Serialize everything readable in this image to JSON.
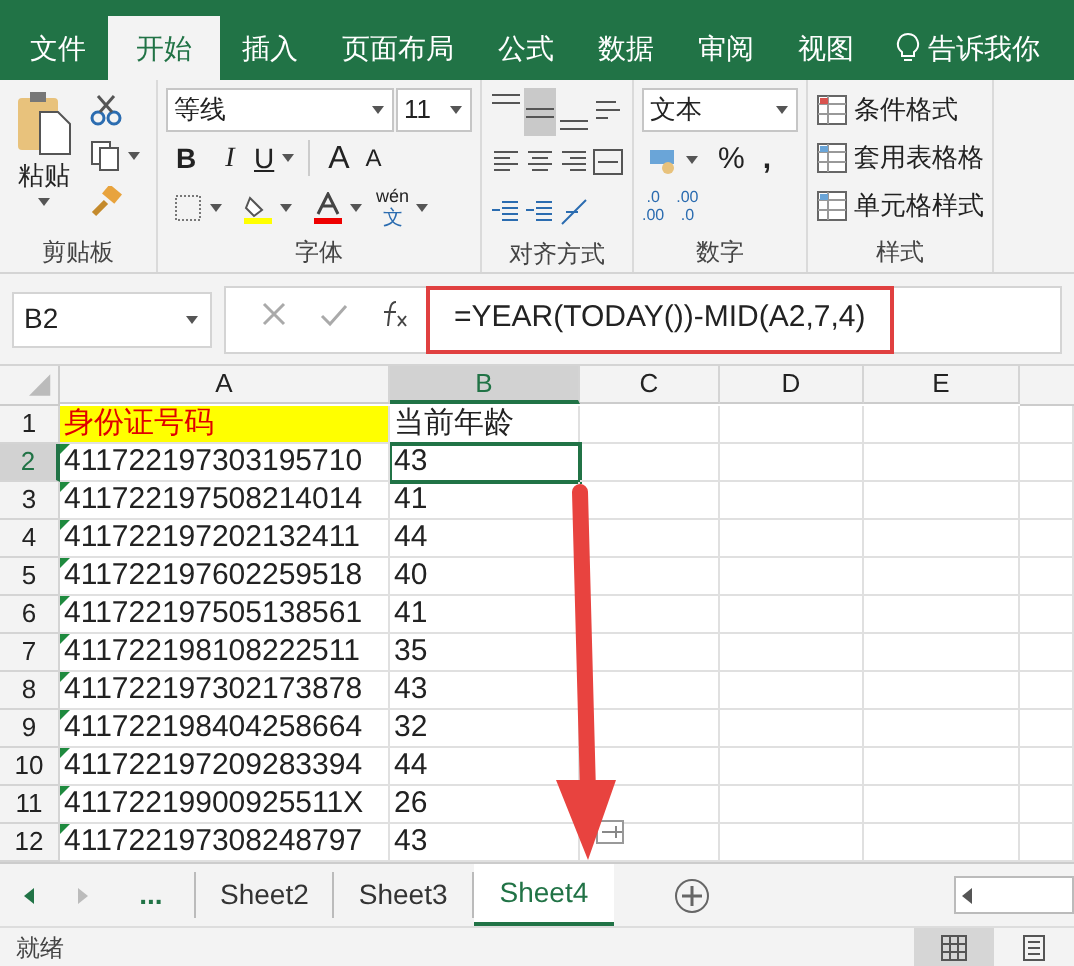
{
  "tabs": [
    {
      "label": "文件",
      "selected": false
    },
    {
      "label": "开始",
      "selected": true
    },
    {
      "label": "插入",
      "selected": false
    },
    {
      "label": "页面布局",
      "selected": false
    },
    {
      "label": "公式",
      "selected": false
    },
    {
      "label": "数据",
      "selected": false
    },
    {
      "label": "审阅",
      "selected": false
    },
    {
      "label": "视图",
      "selected": false
    }
  ],
  "tell_me": "告诉我你",
  "ribbon": {
    "paste": "粘贴",
    "font": "等线",
    "size": "11",
    "bold": "B",
    "italic": "I",
    "underline": "U",
    "grow": "A",
    "shrink": "A",
    "phonetic": {
      "top": "wén",
      "bottom": "文"
    },
    "number_format": "文本",
    "percent": "%",
    "comma": ",",
    "increase_decimal": [
      ".0",
      ".00"
    ],
    "decrease_decimal": [
      ".00",
      ".0"
    ],
    "styles": [
      "条件格式",
      "套用表格格",
      "单元格样式"
    ],
    "groups": [
      "剪贴板",
      "字体",
      "对齐方式",
      "数字",
      "样式"
    ]
  },
  "name_box": "B2",
  "formula": {
    "text": "=YEAR(TODAY())-MID(A2,7,4)",
    "highlighted": true
  },
  "arrow": true,
  "columns": [
    {
      "label": "A",
      "selected": false
    },
    {
      "label": "B",
      "selected": true
    },
    {
      "label": "C",
      "selected": false
    },
    {
      "label": "D",
      "selected": false
    },
    {
      "label": "E",
      "selected": false
    }
  ],
  "rows": [
    {
      "number": "1",
      "id": "身份证号码",
      "age": "当前年龄",
      "kind": "header",
      "selected": false,
      "error_flag": false
    },
    {
      "number": "2",
      "id": "411722197303195710",
      "age": "43",
      "kind": "data",
      "selected": true,
      "error_flag": true
    },
    {
      "number": "3",
      "id": "411722197508214014",
      "age": "41",
      "kind": "data",
      "selected": false,
      "error_flag": true
    },
    {
      "number": "4",
      "id": "411722197202132411",
      "age": "44",
      "kind": "data",
      "selected": false,
      "error_flag": true
    },
    {
      "number": "5",
      "id": "411722197602259518",
      "age": "40",
      "kind": "data",
      "selected": false,
      "error_flag": true
    },
    {
      "number": "6",
      "id": "411722197505138561",
      "age": "41",
      "kind": "data",
      "selected": false,
      "error_flag": true
    },
    {
      "number": "7",
      "id": "411722198108222511",
      "age": "35",
      "kind": "data",
      "selected": false,
      "error_flag": true
    },
    {
      "number": "8",
      "id": "411722197302173878",
      "age": "43",
      "kind": "data",
      "selected": false,
      "error_flag": true
    },
    {
      "number": "9",
      "id": "411722198404258664",
      "age": "32",
      "kind": "data",
      "selected": false,
      "error_flag": true
    },
    {
      "number": "10",
      "id": "411722197209283394",
      "age": "44",
      "kind": "data",
      "selected": false,
      "error_flag": true
    },
    {
      "number": "11",
      "id": "41172219900925511X",
      "age": "26",
      "kind": "data",
      "selected": false,
      "error_flag": true
    },
    {
      "number": "12",
      "id": "411722197308248797",
      "age": "43",
      "kind": "data",
      "selected": false,
      "error_flag": true
    }
  ],
  "sheet_more": "...",
  "sheets": [
    {
      "label": "Sheet2",
      "selected": false
    },
    {
      "label": "Sheet3",
      "selected": false
    },
    {
      "label": "Sheet4",
      "selected": true
    }
  ],
  "status": "就绪"
}
